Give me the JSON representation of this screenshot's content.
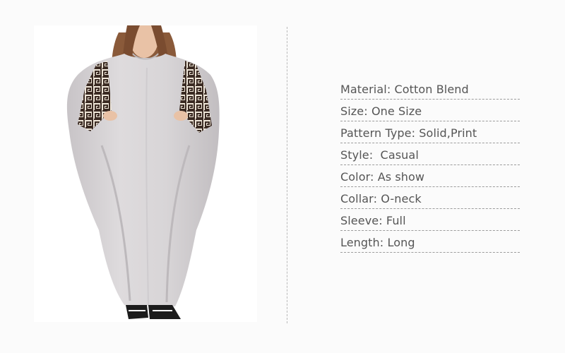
{
  "product_image": {
    "name": "long batwing-sleeve maxi dress",
    "colors": {
      "dress": "#d6d3d5",
      "dress_shadow": "#bdb9bc",
      "trim": "#3a2a22",
      "trim_light": "#efe6d8",
      "hair": "#8a5a3a",
      "skin": "#e9c2a6",
      "shoes": "#1c1c1c"
    }
  },
  "specs": [
    {
      "key": "Material",
      "value": "Cotton Blend"
    },
    {
      "key": "Size",
      "value": "One Size"
    },
    {
      "key": "Pattern Type",
      "value": "Solid,Print"
    },
    {
      "key": "Style",
      "value": " Casual"
    },
    {
      "key": "Color",
      "value": "As show"
    },
    {
      "key": "Collar",
      "value": "O-neck"
    },
    {
      "key": "Sleeve",
      "value": "Full"
    },
    {
      "key": "Length",
      "value": "Long"
    }
  ]
}
